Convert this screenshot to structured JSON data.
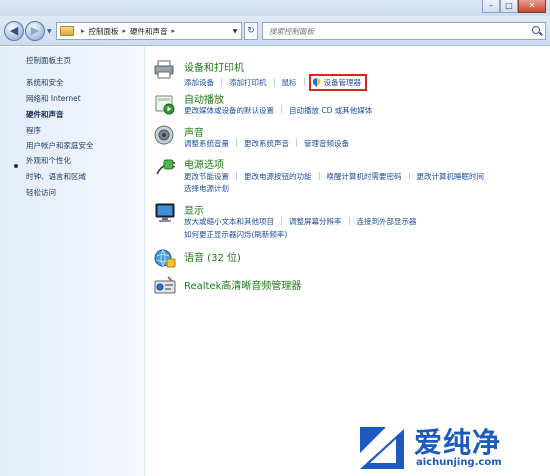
{
  "window": {
    "minimize_glyph": "–",
    "maximize_glyph": "□",
    "close_glyph": "✕"
  },
  "navbar": {
    "back_glyph": "◀",
    "forward_glyph": "▶",
    "breadcrumbs": [
      "控制面板",
      "硬件和声音"
    ],
    "breadcrumb_separator": "▸",
    "refresh_glyph": "↻",
    "search_placeholder": "搜索控制面板"
  },
  "sidebar": {
    "items": [
      {
        "label": "控制面板主页"
      },
      {
        "label": "系统和安全"
      },
      {
        "label": "网络和 Internet"
      },
      {
        "label": "硬件和声音",
        "active": true
      },
      {
        "label": "程序"
      },
      {
        "label": "用户帐户和家庭安全"
      },
      {
        "label": "外观和个性化"
      },
      {
        "label": "时钟、语言和区域"
      },
      {
        "label": "轻松访问"
      }
    ]
  },
  "categories": {
    "devices": {
      "title": "设备和打印机",
      "links": [
        "添加设备",
        "添加打印机",
        "鼠标",
        "设备管理器"
      ]
    },
    "autoplay": {
      "title": "自动播放",
      "links": [
        "更改媒体或设备的默认设置",
        "自动播放 CD 或其他媒体"
      ]
    },
    "sound": {
      "title": "声音",
      "links": [
        "调整系统音量",
        "更改系统声音",
        "管理音频设备"
      ]
    },
    "power": {
      "title": "电源选项",
      "links_row1": [
        "更改节能设置",
        "更改电源按钮的功能",
        "唤醒计算机时需要密码",
        "更改计算机睡眠时间"
      ],
      "links_row2": [
        "选择电源计划"
      ]
    },
    "display": {
      "title": "显示",
      "links_row1": [
        "放大或缩小文本和其他项目",
        "调整屏幕分辨率",
        "连接到外部显示器"
      ],
      "links_row2": [
        "如何更正显示器闪烁(刷新频率)"
      ]
    },
    "language": {
      "title": "语音 (32 位)"
    },
    "realtek": {
      "title": "Realtek高清晰音频管理器"
    }
  },
  "watermark": {
    "brand": "爱纯净",
    "url": "aichunjing.com"
  },
  "colors": {
    "category_title": "#1f7a17",
    "link": "#1e4e9c",
    "highlight_box": "#d9251d",
    "watermark": "#1c5bbd"
  }
}
